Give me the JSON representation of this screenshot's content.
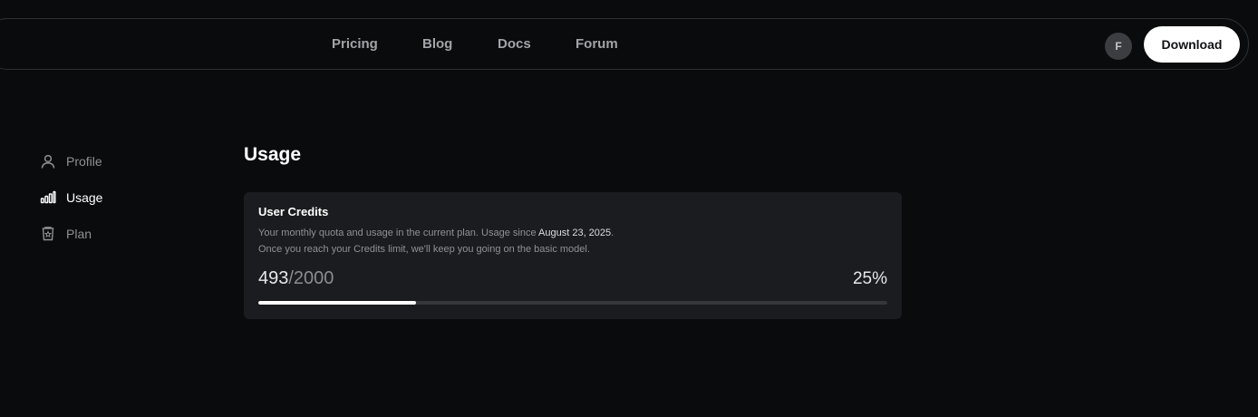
{
  "nav": {
    "links": [
      "Pricing",
      "Blog",
      "Docs",
      "Forum"
    ],
    "avatar_initial": "F",
    "download_label": "Download"
  },
  "sidebar": {
    "items": [
      {
        "label": "Profile",
        "icon": "user-icon",
        "active": false
      },
      {
        "label": "Usage",
        "icon": "bar-chart-icon",
        "active": true
      },
      {
        "label": "Plan",
        "icon": "plan-badge-icon",
        "active": false
      }
    ]
  },
  "main": {
    "title": "Usage",
    "credits": {
      "title": "User Credits",
      "desc_prefix": "Your monthly quota and usage in the current plan. Usage since ",
      "since_date": "August 23, 2025",
      "desc_suffix": ".",
      "desc_line2": "Once you reach your Credits limit, we'll keep you going on the basic model.",
      "used": "493",
      "total": "/2000",
      "percent_label": "25%",
      "progress_fraction": 0.25
    }
  },
  "colors": {
    "background": "#0a0b0d",
    "card": "#1b1c1f",
    "accent": "#ffffff",
    "muted_text": "#8f9195"
  }
}
